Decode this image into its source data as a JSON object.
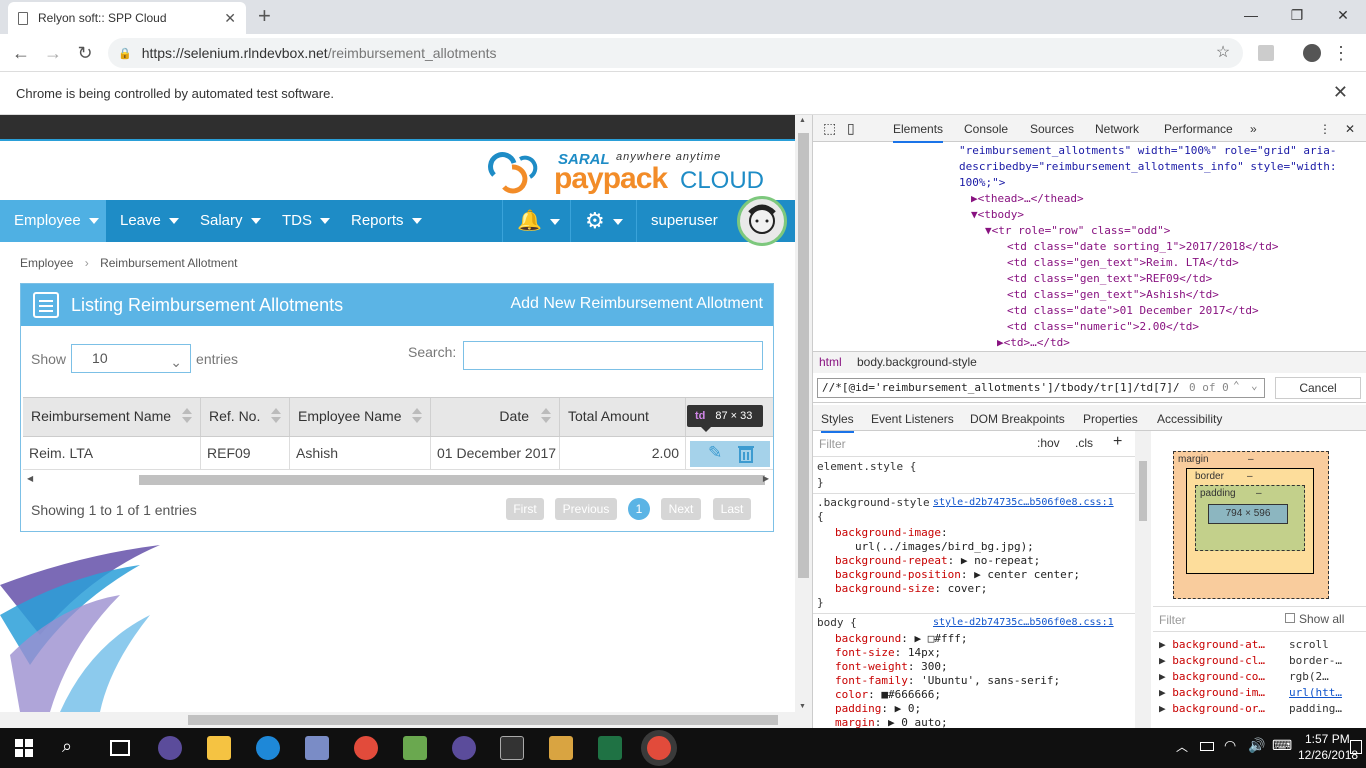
{
  "browser": {
    "tab_title": "Relyon soft:: SPP Cloud",
    "url_host": "https://selenium.rlndevbox.net",
    "url_path": "/reimbursement_allotments",
    "infobar_message": "Chrome is being controlled by automated test software."
  },
  "app": {
    "logo_saral": "SARAL",
    "logo_tagline": "anywhere anytime",
    "logo_paypack": "paypack",
    "logo_cloud": "CLOUD",
    "nav": [
      "Employee",
      "Leave",
      "Salary",
      "TDS",
      "Reports"
    ],
    "username": "superuser",
    "breadcrumb": [
      "Employee",
      "Reimbursement Allotment"
    ]
  },
  "panel": {
    "title": "Listing Reimbursement Allotments",
    "add_link": "Add New Reimbursement Allotment",
    "show_label": "Show",
    "entries_value": "10",
    "entries_label": "entries",
    "search_label": "Search:",
    "columns": [
      "Reimbursement Name",
      "Ref. No.",
      "Employee Name",
      "Date",
      "Total Amount"
    ],
    "row": [
      "Reim. LTA",
      "REF09",
      "Ashish",
      "01 December 2017",
      "2.00"
    ],
    "showing": "Showing 1 to 1 of 1 entries",
    "pager": [
      "First",
      "Previous",
      "1",
      "Next",
      "Last"
    ],
    "tooltip_tag": "td",
    "tooltip_size": "87 × 33"
  },
  "devtools": {
    "tabs": [
      "Elements",
      "Console",
      "Sources",
      "Network",
      "Performance"
    ],
    "dom_lines": [
      "\"reimbursement_allotments\" width=\"100%\" role=\"grid\" aria-",
      "describedby=\"reimbursement_allotments_info\" style=\"width:",
      "100%;\">",
      "▶<thead>…</thead>",
      "▼<tbody>",
      "▼<tr role=\"row\" class=\"odd\">",
      "<td class=\"date sorting_1\">2017/2018</td>",
      "<td class=\"gen_text\">Reim. LTA</td>",
      "<td class=\"gen_text\">REF09</td>",
      "<td class=\"gen_text\">Ashish</td>",
      "<td class=\"date\">01 December 2017</td>",
      "<td class=\"numeric\">2.00</td>",
      "▶<td>…</td>"
    ],
    "crumbs": [
      "html",
      "body.background-style"
    ],
    "find_query": "//*[@id='reimbursement_allotments']/tbody/tr[1]/td[7]/",
    "find_count": "0 of 0",
    "cancel": "Cancel",
    "styles_tabs": [
      "Styles",
      "Event Listeners",
      "DOM Breakpoints",
      "Properties",
      "Accessibility"
    ],
    "filter_placeholder": "Filter",
    "hov": ":hov",
    "cls": ".cls",
    "element_style": "element.style {",
    "rule1_selector": ".background-style",
    "rule1_source": "style-d2b74735c…b506f0e8.css:1",
    "rule1_props": [
      [
        "background-image",
        ":"
      ],
      [
        "",
        "url(../images/bird_bg.jpg);"
      ],
      [
        "background-repeat",
        ": ▶ no-repeat;"
      ],
      [
        "background-position",
        ": ▶ center center;"
      ],
      [
        "background-size",
        ": cover;"
      ]
    ],
    "rule2_selector": "body {",
    "rule2_source": "style-d2b74735c…b506f0e8.css:1",
    "rule2_props": [
      [
        "background",
        ": ▶ □#fff;"
      ],
      [
        "font-size",
        ": 14px;"
      ],
      [
        "font-weight",
        ": 300;"
      ],
      [
        "font-family",
        ": 'Ubuntu', sans-serif;"
      ],
      [
        "color",
        ": ■#666666;"
      ],
      [
        "padding",
        ": ▶ 0;"
      ],
      [
        "margin",
        ": ▶ 0 auto;"
      ]
    ],
    "box": {
      "margin": "margin",
      "border": "border",
      "padding": "padding",
      "content": "794 × 596",
      "dash": "–"
    },
    "computed_filter": "Filter",
    "show_all": "Show all",
    "computed": [
      [
        "background-at…",
        "scroll"
      ],
      [
        "background-cl…",
        "border-…"
      ],
      [
        "background-co…",
        "rgb(2…"
      ],
      [
        "background-im…",
        "url(htt…"
      ],
      [
        "background-or…",
        "padding…"
      ]
    ]
  },
  "taskbar": {
    "time": "1:57 PM",
    "date": "12/26/2018"
  }
}
